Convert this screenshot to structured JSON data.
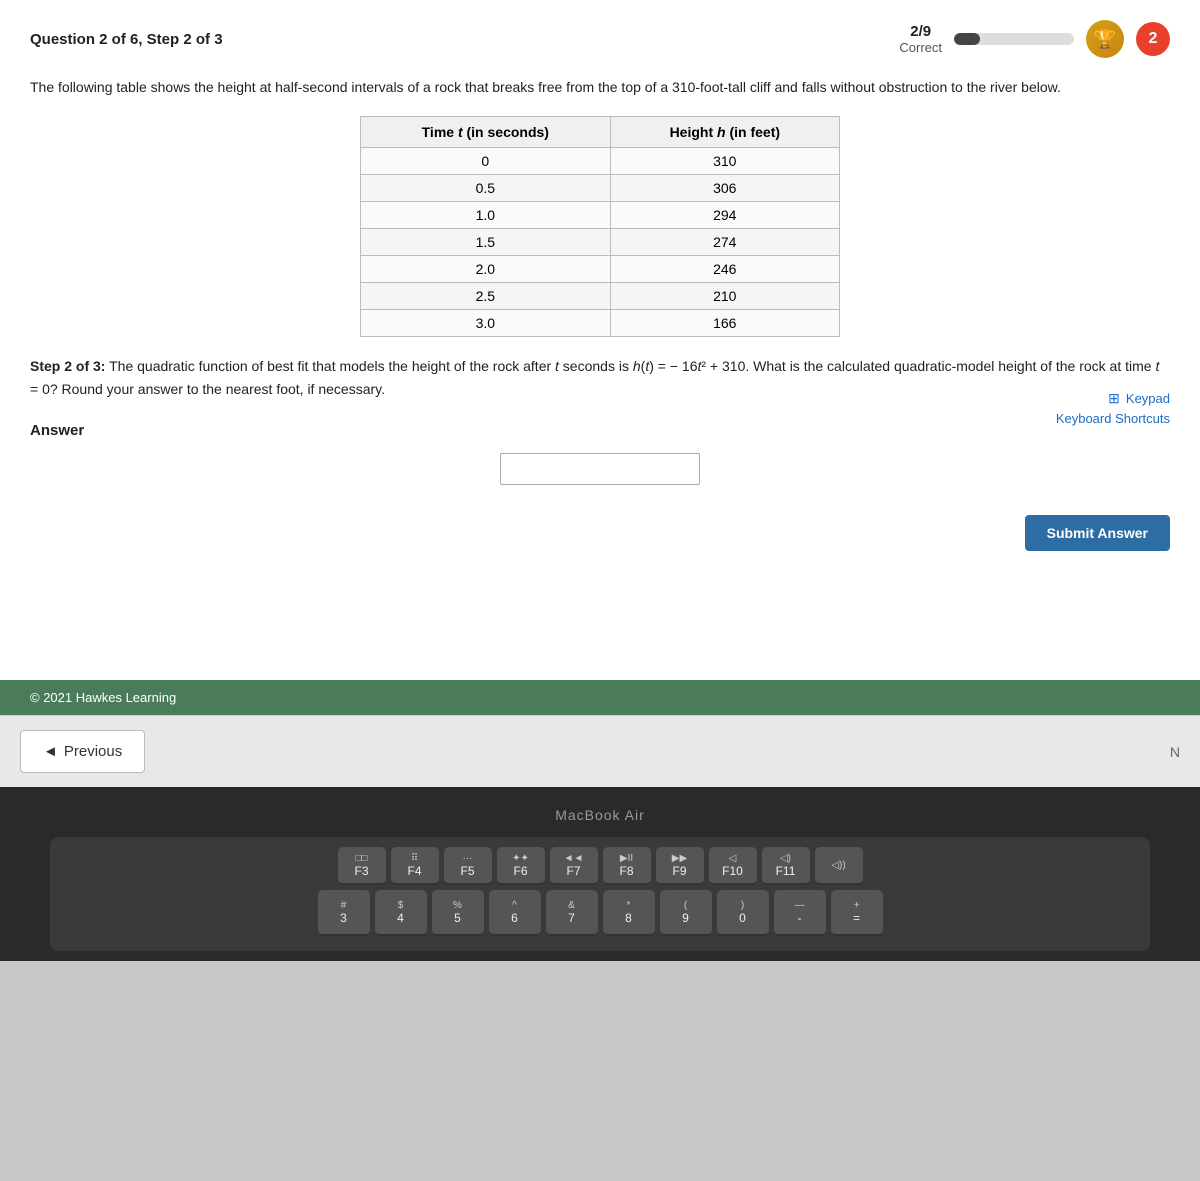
{
  "header": {
    "question_label": "Question 2 of 6, Step 2 of 3",
    "score": "2/9",
    "score_sublabel": "Correct",
    "progress_percent": 22,
    "attempt_number": "2"
  },
  "question": {
    "intro": "The following table shows the height at half-second intervals of a rock that breaks free from the top of a 310-foot-tall cliff and falls without obstruction to the river below.",
    "table": {
      "col1_header": "Time t (in seconds)",
      "col2_header": "Height h (in feet)",
      "rows": [
        {
          "time": "0",
          "height": "310"
        },
        {
          "time": "0.5",
          "height": "306"
        },
        {
          "time": "1.0",
          "height": "294"
        },
        {
          "time": "1.5",
          "height": "274"
        },
        {
          "time": "2.0",
          "height": "246"
        },
        {
          "time": "2.5",
          "height": "210"
        },
        {
          "time": "3.0",
          "height": "166"
        }
      ]
    },
    "step_text_prefix": "Step 2 of 3:",
    "step_text": " The quadratic function of best fit that models the height of the rock after t seconds is h(t) = − 16t² + 310. What is the calculated quadratic-model height of the rock at time t = 0? Round your answer to the nearest foot, if necessary.",
    "answer_label": "Answer",
    "keypad_label": "Keypad",
    "keyboard_shortcuts_label": "Keyboard Shortcuts",
    "submit_label": "Submit Answer"
  },
  "footer": {
    "copyright": "© 2021 Hawkes Learning"
  },
  "navigation": {
    "previous_label": "◄ Previous"
  },
  "keyboard": {
    "brand": "MacBook Air",
    "fn_row": [
      "F3",
      "F4",
      "F5",
      "F6",
      "F7",
      "F8",
      "F9",
      "F10",
      "F11",
      ""
    ],
    "fn_icons": [
      "□□",
      "⠿",
      "···",
      "✦✦",
      "◄◄",
      "▶II",
      "▶▶",
      "◁",
      "◁)",
      "◁))",
      "◁)))"
    ],
    "number_row": [
      "#/3",
      "$/4",
      "%/5",
      "^/6",
      "&/7",
      "*/8",
      "(/9",
      ")/0",
      "-",
      "="
    ],
    "bottom_row_nums": [
      "3",
      "4",
      "5",
      "6",
      "7",
      "8",
      "9",
      "0",
      "-",
      "="
    ]
  }
}
